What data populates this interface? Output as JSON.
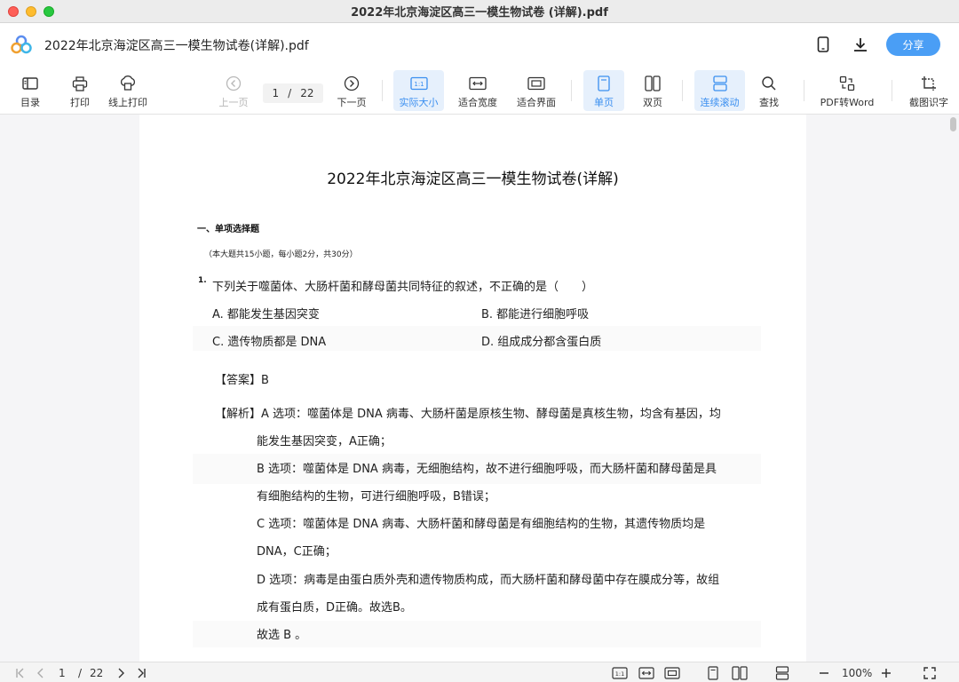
{
  "window": {
    "title": "2022年北京海淀区高三一模生物试卷 (详解).pdf"
  },
  "header": {
    "doc_title": "2022年北京海淀区高三一模生物试卷(详解).pdf",
    "share_label": "分享"
  },
  "toolbar": {
    "toc": "目录",
    "print": "打印",
    "online_print": "线上打印",
    "prev_page": "上一页",
    "current_page": "1",
    "page_sep": "/",
    "total_pages": "22",
    "next_page": "下一页",
    "actual_size": "实际大小",
    "actual_size_glyph": "1:1",
    "fit_width": "适合宽度",
    "fit_page": "适合界面",
    "single_page": "单页",
    "double_page": "双页",
    "continuous_scroll": "连续滚动",
    "find": "查找",
    "pdf_to_word": "PDF转Word",
    "ocr": "截图识字"
  },
  "document": {
    "title": "2022年北京海淀区高三一模生物试卷(详解)",
    "section_heading": "一、单项选择题",
    "section_note": "（本大题共15小题，每小题2分，共30分）",
    "question_number": "1.",
    "question": "下列关于噬菌体、大肠杆菌和酵母菌共同特征的叙述，不正确的是（　　）",
    "options": [
      "A. 都能发生基因突变",
      "B. 都能进行细胞呼吸",
      "C. 遗传物质都是 DNA",
      "D. 组成成分都含蛋白质"
    ],
    "answer_line": "【答案】B",
    "analysis_lines": [
      "【解析】A 选项：噬菌体是 DNA 病毒、大肠杆菌是原核生物、酵母菌是真核生物，均含有基因，均",
      "能发生基因突变，A正确；",
      "B 选项：噬菌体是 DNA 病毒，无细胞结构，故不进行细胞呼吸，而大肠杆菌和酵母菌是具",
      "有细胞结构的生物，可进行细胞呼吸，B错误；",
      "C 选项：噬菌体是 DNA 病毒、大肠杆菌和酵母菌是有细胞结构的生物，其遗传物质均是",
      "DNA，C正确；",
      "D 选项：病毒是由蛋白质外壳和遗传物质构成，而大肠杆菌和酵母菌中存在膜成分等，故组",
      "成有蛋白质，D正确。故选B。",
      "故选 B 。"
    ]
  },
  "bottombar": {
    "current_page": "1",
    "page_sep": "/",
    "total_pages": "22",
    "zoom": "100%",
    "actual_size_glyph": "1:1"
  },
  "colors": {
    "accent": "#4a9ef5",
    "active_bg": "#e6f0fc",
    "active_text": "#3b8ff0"
  }
}
